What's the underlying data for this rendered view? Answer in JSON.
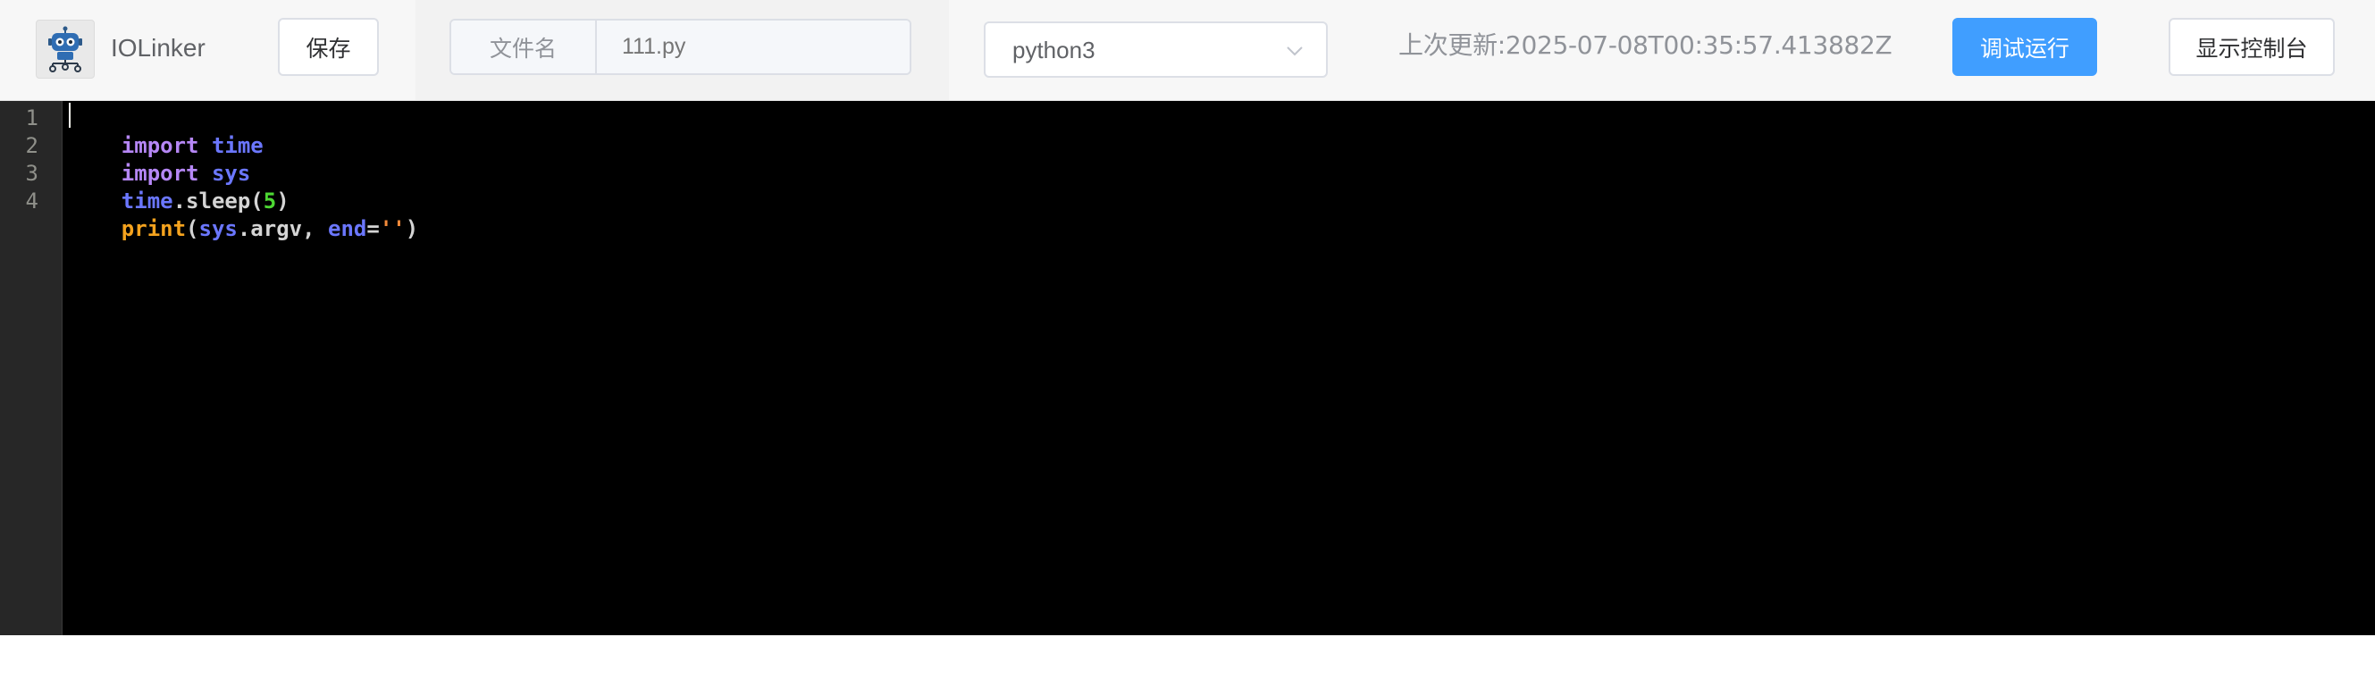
{
  "header": {
    "app_name": "IOLinker",
    "save_label": "保存",
    "file_label": "文件名",
    "file_placeholder": "111.py",
    "file_value": "",
    "language_selected": "python3",
    "last_updated": "上次更新:2025-07-08T00:35:57.413882Z",
    "run_label": "调试运行",
    "console_label": "显示控制台"
  },
  "editor": {
    "line_numbers": [
      "1",
      "2",
      "3",
      "4"
    ],
    "lines": [
      {
        "tokens": [
          {
            "text": "import",
            "kind": "keyword"
          },
          {
            "text": " ",
            "kind": "plain"
          },
          {
            "text": "time",
            "kind": "module"
          }
        ]
      },
      {
        "tokens": [
          {
            "text": "import",
            "kind": "keyword"
          },
          {
            "text": " ",
            "kind": "plain"
          },
          {
            "text": "sys",
            "kind": "module"
          }
        ]
      },
      {
        "tokens": [
          {
            "text": "time",
            "kind": "module"
          },
          {
            "text": ".sleep(",
            "kind": "plain"
          },
          {
            "text": "5",
            "kind": "number"
          },
          {
            "text": ")",
            "kind": "plain"
          }
        ]
      },
      {
        "tokens": [
          {
            "text": "print",
            "kind": "builtin"
          },
          {
            "text": "(",
            "kind": "plain"
          },
          {
            "text": "sys",
            "kind": "module"
          },
          {
            "text": ".argv, ",
            "kind": "plain"
          },
          {
            "text": "end",
            "kind": "module"
          },
          {
            "text": "=",
            "kind": "plain"
          },
          {
            "text": "''",
            "kind": "string"
          },
          {
            "text": ")",
            "kind": "plain"
          }
        ]
      }
    ]
  },
  "colors": {
    "accent": "#409eff",
    "editor_bg": "#000000",
    "gutter_bg": "#272727"
  },
  "icons": {
    "logo": "robot-logo-icon",
    "select_arrow": "chevron-down-icon"
  }
}
